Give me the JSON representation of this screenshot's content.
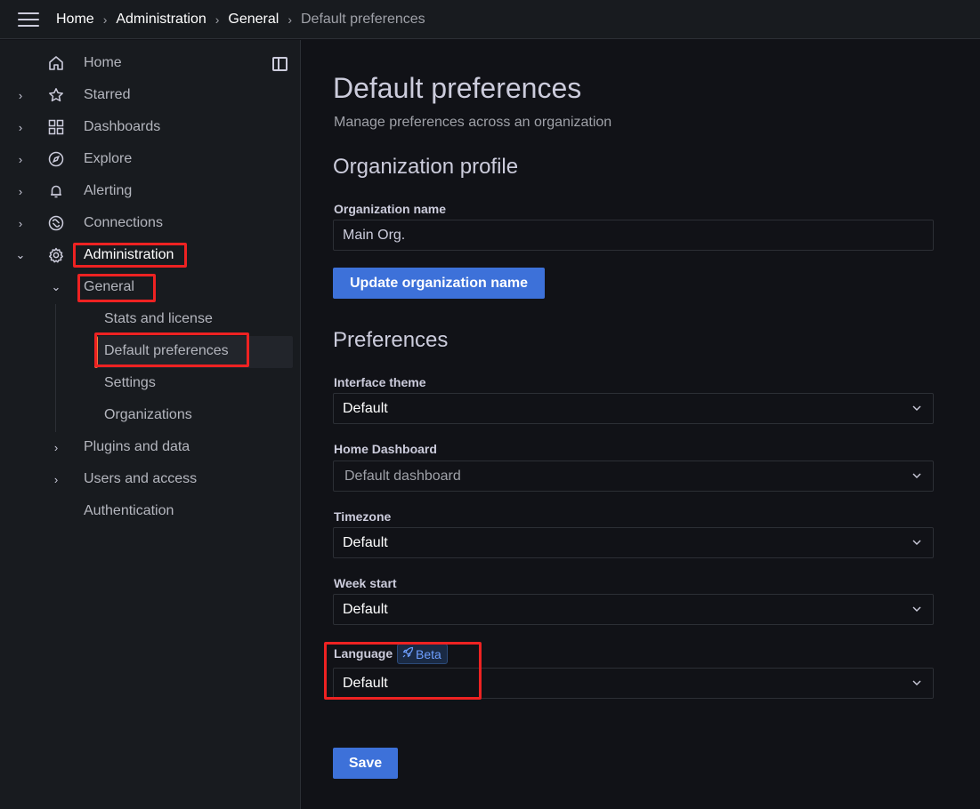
{
  "header": {
    "breadcrumbs": [
      "Home",
      "Administration",
      "General",
      "Default preferences"
    ],
    "separator": "›"
  },
  "sidebar": {
    "items": [
      {
        "label": "Home",
        "icon": "home-icon"
      },
      {
        "label": "Starred",
        "icon": "star-icon"
      },
      {
        "label": "Dashboards",
        "icon": "dashboards-grid-icon"
      },
      {
        "label": "Explore",
        "icon": "compass-icon"
      },
      {
        "label": "Alerting",
        "icon": "bell-icon"
      },
      {
        "label": "Connections",
        "icon": "connections-icon"
      },
      {
        "label": "Administration",
        "icon": "gear-icon"
      }
    ],
    "admin_children": {
      "general": "General",
      "general_children": [
        "Stats and license",
        "Default preferences",
        "Settings",
        "Organizations"
      ],
      "plugins": "Plugins and data",
      "users": "Users and access",
      "auth": "Authentication"
    }
  },
  "main": {
    "title": "Default preferences",
    "subtitle": "Manage preferences across an organization",
    "org_profile": {
      "title": "Organization profile",
      "name_label": "Organization name",
      "name_value": "Main Org.",
      "update_button": "Update organization name"
    },
    "preferences": {
      "title": "Preferences",
      "theme_label": "Interface theme",
      "theme_value": "Default",
      "home_dashboard_label": "Home Dashboard",
      "home_dashboard_placeholder": "Default dashboard",
      "timezone_label": "Timezone",
      "timezone_value": "Default",
      "week_start_label": "Week start",
      "week_start_value": "Default",
      "language_label": "Language",
      "language_badge": "Beta",
      "language_value": "Default",
      "save_button": "Save"
    }
  },
  "colors": {
    "accent": "#3d71d9",
    "highlight_box": "#ee2222",
    "active_bar": "#f55f3e",
    "background": "#111217",
    "sidebar": "#181b1f"
  }
}
